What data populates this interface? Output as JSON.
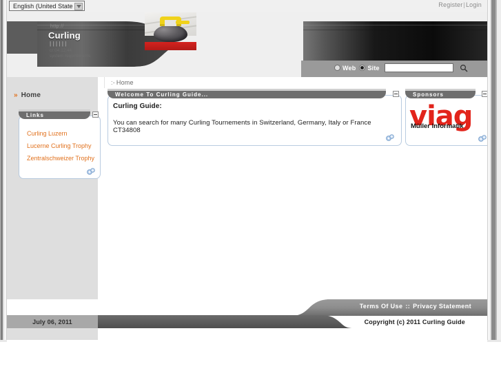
{
  "window": {
    "title": "Curling Guide"
  },
  "topbar": {
    "language": "English (United State",
    "language_arrow_icon": "chevron-down-icon",
    "register_label": "Register",
    "separator": "|",
    "login_label": "Login"
  },
  "header": {
    "site_name": "Curling",
    "banner_ghost_line1": "http://",
    "banner_ghost_line2": "||||||",
    "banner_ghost_line3": "cr:04:12:44\nsystem requirements",
    "logo_icon": "curling-stone-photo"
  },
  "search": {
    "web_label": "Web",
    "site_label": "Site",
    "selected": "Site",
    "value": "",
    "placeholder": "",
    "go_icon": "magnifier-icon"
  },
  "breadcrumb": {
    "arrow": ":-",
    "current": "Home"
  },
  "sidebar": {
    "nav": {
      "chevron": "»",
      "home_label": "Home"
    },
    "links_panel": {
      "title": "Links",
      "minimize_icon": "minimize-icon",
      "settings_icon": "settings-gears-icon",
      "items": [
        {
          "label": "Curling Luzern"
        },
        {
          "label": "Lucerne Curling Trophy"
        },
        {
          "label": "Zentralschweizer Trophy"
        }
      ]
    }
  },
  "main": {
    "welcome_panel": {
      "title": "Welcome To Curling Guide...",
      "minimize_icon": "minimize-icon",
      "settings_icon": "settings-gears-icon",
      "heading": "Curling Guide:",
      "body": "You can search for many Curling Tournements in Switzerland, Germany, Italy or France CT34808"
    }
  },
  "sponsors": {
    "panel": {
      "title": "Sponsors",
      "minimize_icon": "minimize-icon",
      "settings_icon": "settings-gears-icon"
    },
    "logo_wordmark": "viag",
    "logo_tagline": "Müller Informatik",
    "logo_color": "#e2241b"
  },
  "footer": {
    "terms_label": "Terms Of Use",
    "separator": "::",
    "privacy_label": "Privacy Statement",
    "date": "July 06, 2011",
    "copyright": "Copyright (c) 2011 Curling Guide"
  },
  "colors": {
    "accent_link": "#e1711d",
    "panel_header": "#6e6e6e",
    "sidebar_bg": "#dedede",
    "brand_red": "#e2241b"
  }
}
